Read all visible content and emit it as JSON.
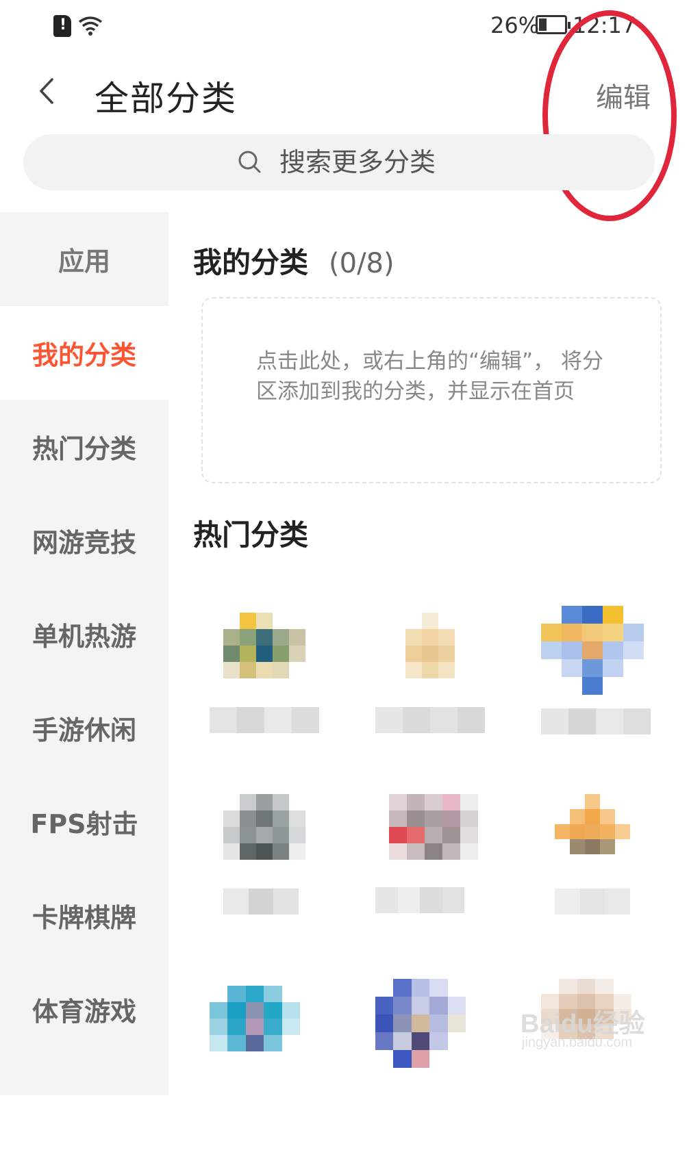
{
  "status_bar": {
    "battery_percent": "26%",
    "time": "12:17",
    "icons": [
      "sim-alert-icon",
      "wifi-icon",
      "battery-charging-icon"
    ]
  },
  "header": {
    "back_icon": "chevron-left-icon",
    "title": "全部分类",
    "edit_label": "编辑"
  },
  "search": {
    "icon": "search-icon",
    "placeholder": "搜索更多分类"
  },
  "sidebar": {
    "items": [
      {
        "label": "应用"
      },
      {
        "label": "我的分类"
      },
      {
        "label": "热门分类"
      },
      {
        "label": "网游竞技"
      },
      {
        "label": "单机热游"
      },
      {
        "label": "手游休闲"
      },
      {
        "label": "FPS射击"
      },
      {
        "label": "卡牌棋牌"
      },
      {
        "label": "体育游戏"
      }
    ],
    "active_index": 1,
    "active_color": "#fb5533"
  },
  "my_categories": {
    "title": "我的分类",
    "count": "(0/8)",
    "empty_hint": "点击此处，或右上角的“编辑”， 将分区添加到我的分类，并显示在首页"
  },
  "hot_categories": {
    "title": "热门分类",
    "items_note": "category icons and labels are pixelated/blurred in the screenshot"
  },
  "watermark": {
    "logo": "Baidu经验",
    "sub": "jingyan.baidu.com"
  },
  "colors": {
    "accent": "#fb5533",
    "annotation": "#e0263a",
    "sidebar_bg": "#f4f4f4",
    "search_bg": "#f2f2f2"
  }
}
